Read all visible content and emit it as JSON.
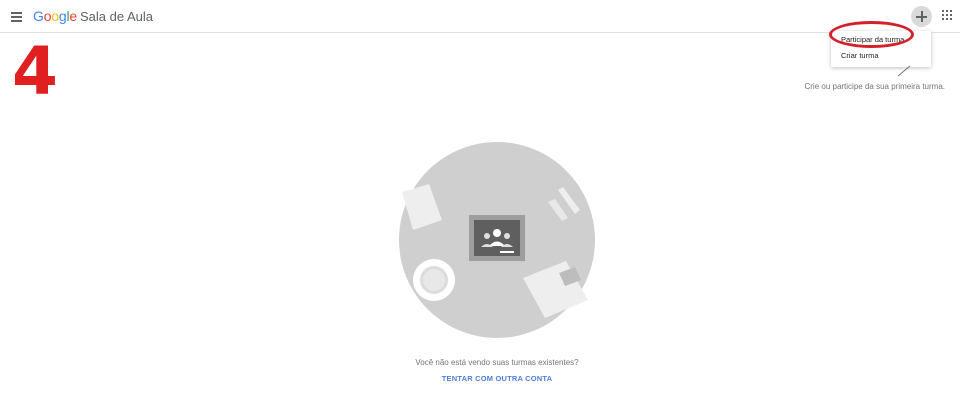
{
  "header": {
    "google_letters": [
      "G",
      "o",
      "o",
      "g",
      "l",
      "e"
    ],
    "app_name": "Sala de Aula"
  },
  "annotation": {
    "step_number": "4"
  },
  "add_menu": {
    "items": [
      {
        "label": "Participar da turma"
      },
      {
        "label": "Criar turma"
      }
    ]
  },
  "hint": {
    "text": "Crie ou participe da sua primeira turma."
  },
  "empty_state": {
    "message": "Você não está vendo suas turmas existentes?",
    "action_label": "TENTAR COM OUTRA CONTA"
  },
  "colors": {
    "annotation_red": "#e02020",
    "link_blue": "#4f7fd9",
    "illustration_gray": "#cfcfcf"
  }
}
